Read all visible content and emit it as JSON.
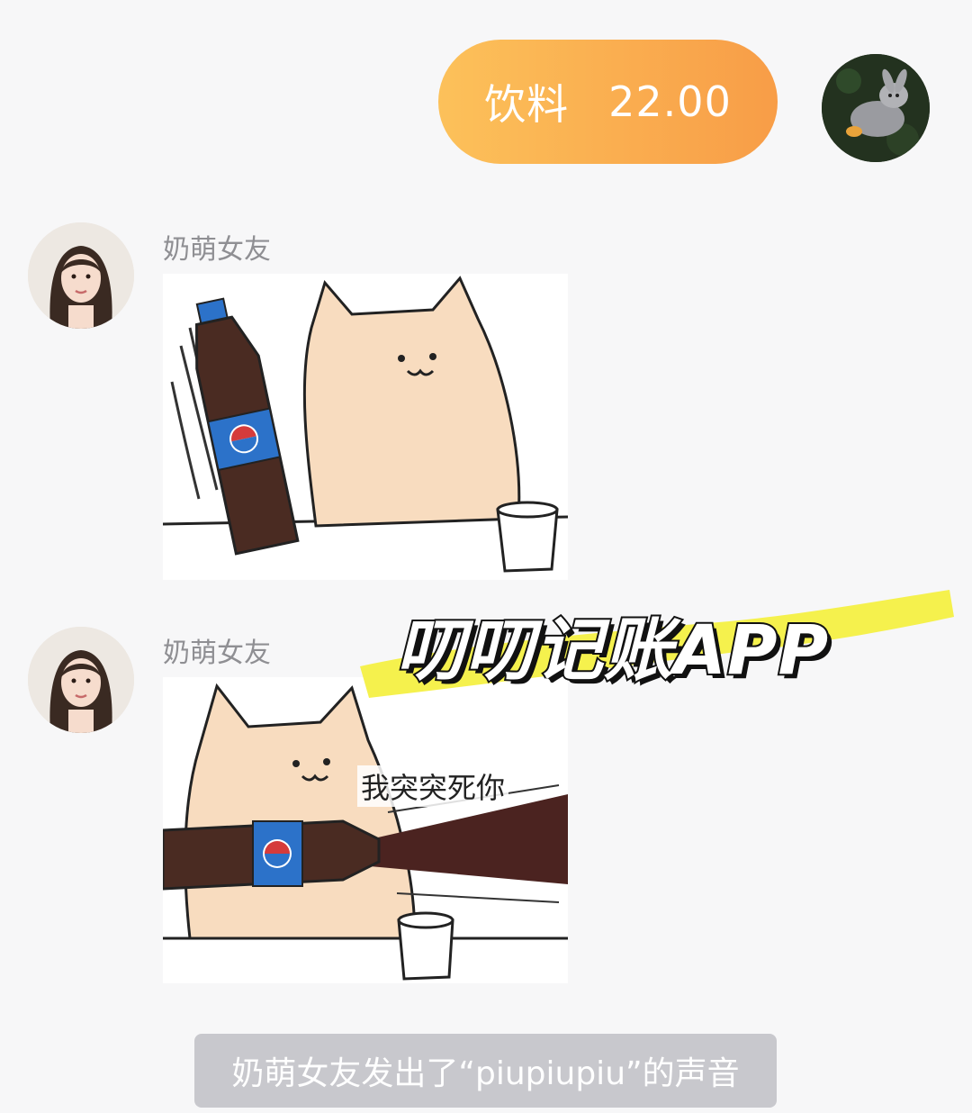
{
  "outgoing_message": {
    "category": "饮料",
    "amount": "22.00"
  },
  "messages": [
    {
      "sender": "奶萌女友"
    },
    {
      "sender": "奶萌女友",
      "sticker_caption": "我突突死你"
    }
  ],
  "system_notice": "奶萌女友发出了“piupiupiu”的声音",
  "watermark": "叨叨记账APP",
  "colors": {
    "bubble_gradient_start": "#fcc15a",
    "bubble_gradient_end": "#f89d47",
    "highlight": "#f4f03a",
    "background": "#f7f7f8"
  }
}
